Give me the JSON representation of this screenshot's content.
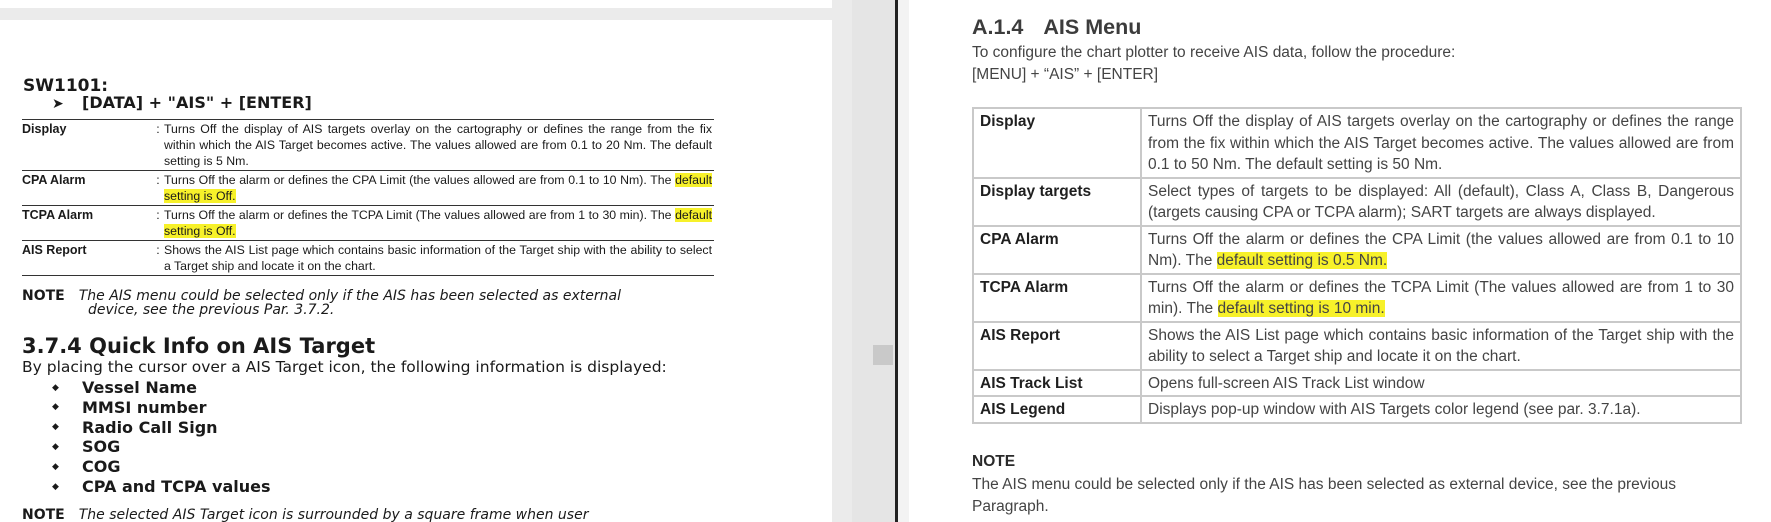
{
  "left_doc": {
    "section_id": "SW1101:",
    "command": "[DATA] + \"AIS\" + [ENTER]",
    "command_arrow": "➤",
    "separator": ":",
    "rows": [
      {
        "key": "Display",
        "value": "Turns Off the display of AIS targets overlay on the cartography or defines the range from the fix within which the AIS Target becomes active. The values allowed are from 0.1 to 20 Nm. The default setting is 5 Nm."
      },
      {
        "key": "CPA Alarm",
        "value": "Turns Off the alarm or defines the CPA Limit (the values allowed are from 0.1 to 10 Nm). The ",
        "highlight": "default setting is Off."
      },
      {
        "key": "TCPA Alarm",
        "value": "Turns Off the alarm or defines the TCPA Limit (The values allowed are from 1 to 30 min). The ",
        "highlight": "default setting is Off."
      },
      {
        "key": "AIS Report",
        "value": "Shows the AIS List page which contains basic information of the Target ship with the ability to select a Target ship and locate it on the chart."
      }
    ],
    "note_label": "NOTE",
    "note_text": "The AIS menu could be selected only if the AIS has been selected as external",
    "note_text_cont": "device, see the previous Par. 3.7.2.",
    "section_title": "3.7.4  Quick Info on AIS Target",
    "section_intro": "By placing the cursor over a AIS Target icon, the following information is displayed:",
    "bullet_glyph": "◆",
    "bullets": [
      "Vessel Name",
      "MMSI number",
      "Radio Call Sign",
      "SOG",
      "COG",
      "CPA and TCPA values"
    ],
    "note2_label": "NOTE",
    "note2_text": "The selected AIS Target icon is surrounded by a square frame when user"
  },
  "right_doc": {
    "section_number": "A.1.4",
    "section_title": "AIS Menu",
    "intro_line1": "To configure the chart plotter to receive AIS data, follow the procedure:",
    "intro_line2": "[MENU] + “AIS” + [ENTER]",
    "rows": [
      {
        "key": "Display",
        "value": "Turns Off the display of AIS targets overlay on the cartography or defines the range from the fix within which the AIS Target becomes active. The values allowed are from 0.1 to 50 Nm. The default setting is 50 Nm."
      },
      {
        "key": "Display targets",
        "value": "Select types of targets to be displayed: All (default), Class A, Class B, Dangerous (targets causing CPA or TCPA alarm); SART targets are always displayed."
      },
      {
        "key": "CPA Alarm",
        "value": "Turns Off the alarm or defines the CPA Limit (the values allowed are from 0.1 to 10 Nm). The ",
        "highlight": "default setting is 0.5 Nm."
      },
      {
        "key": "TCPA Alarm",
        "value": "Turns Off the alarm or defines the TCPA Limit (The values allowed are from 1 to 30 min). The ",
        "highlight": "default setting is 10 min."
      },
      {
        "key": "AIS Report",
        "value": "Shows the AIS List page which contains basic information of the Target ship with the ability to select a Target ship and locate it on the chart."
      },
      {
        "key": "AIS Track List",
        "value": "Opens full-screen AIS Track List window"
      },
      {
        "key": "AIS Legend",
        "value": "Displays pop-up window with AIS Targets color legend (see par. 3.7.1a)."
      }
    ],
    "note_label": "NOTE",
    "note_text": "The AIS menu could be selected only if the AIS has been selected as external device, see the previous Paragraph."
  },
  "colors": {
    "highlight": "#f7f12a",
    "divider": "#222222",
    "table_border": "#c9c9c9"
  }
}
